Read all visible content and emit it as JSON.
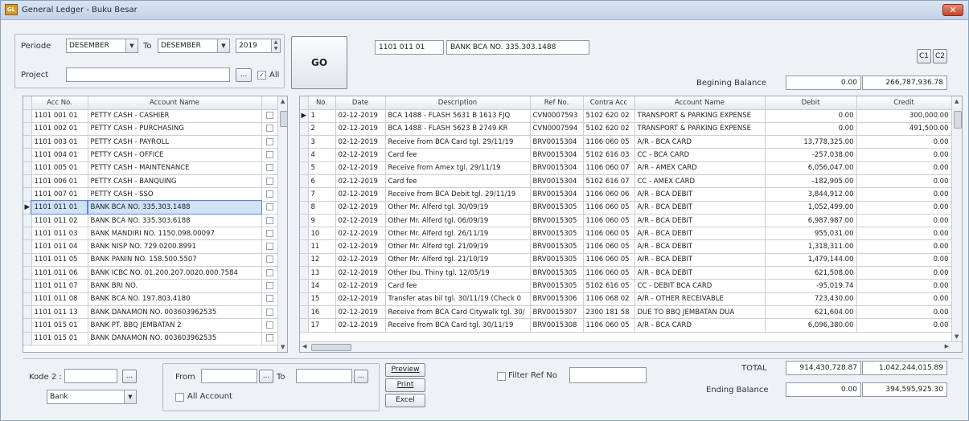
{
  "window": {
    "title": "General Ledger - Buku Besar",
    "close_label": "✕",
    "app_icon_label": "GL"
  },
  "filters": {
    "periode_label": "Periode",
    "period_from": "DESEMBER",
    "to_label": "To",
    "period_to": "DESEMBER",
    "year": "2019",
    "project_label": "Project",
    "project_value": "",
    "project_browse": "...",
    "all_label": "All",
    "go_label": "GO"
  },
  "account_header": {
    "code": "1101 011 01",
    "name": "BANK BCA NO. 335.303.1488",
    "c1_label": "C1",
    "c2_label": "C2"
  },
  "beginning_balance": {
    "label": "Begining Balance",
    "debit": "0.00",
    "credit": "266,787,936.78"
  },
  "accounts": {
    "headers": [
      "Acc No.",
      "Account Name"
    ],
    "rows": [
      {
        "no": "1101 001 01",
        "name": "PETTY CASH - CASHIER"
      },
      {
        "no": "1101 002 01",
        "name": "PETTY CASH - PURCHASING"
      },
      {
        "no": "1101 003 01",
        "name": "PETTY CASH - PAYROLL"
      },
      {
        "no": "1101 004 01",
        "name": "PETTY CASH - OFFICE"
      },
      {
        "no": "1101 005 01",
        "name": "PETTY CASH - MAINTENANCE"
      },
      {
        "no": "1101 006 01",
        "name": "PETTY CASH - BANQUING"
      },
      {
        "no": "1101 007 01",
        "name": "PETTY CASH - SSO"
      },
      {
        "no": "1101 011 01",
        "name": "BANK BCA NO. 335.303.1488"
      },
      {
        "no": "1101 011 02",
        "name": "BANK BCA NO. 335.303.6188"
      },
      {
        "no": "1101 011 03",
        "name": "BANK MANDIRI NO. 1150.098.00097"
      },
      {
        "no": "1101 011 04",
        "name": "BANK NISP NO. 729.0200.8991"
      },
      {
        "no": "1101 011 05",
        "name": "BANK PANIN NO. 158.500.5507"
      },
      {
        "no": "1101 011 06",
        "name": "BANK ICBC NO. 01.200.207.0020.000.7584"
      },
      {
        "no": "1101 011 07",
        "name": "BANK BRI NO."
      },
      {
        "no": "1101 011 08",
        "name": "BANK BCA NO. 197.803.4180"
      },
      {
        "no": "1101 011 13",
        "name": "BANK DANAMON NO. 003603962535"
      },
      {
        "no": "1101 015 01",
        "name": "BANK PT. BBQ JEMBATAN 2"
      },
      {
        "no": "1101 015 01",
        "name": "BANK DANAMON NO. 003603962535"
      }
    ]
  },
  "ledger": {
    "headers": [
      "No.",
      "Date",
      "Description",
      "Ref No.",
      "Contra Acc",
      "Account Name",
      "Debit",
      "Credit"
    ],
    "rows": [
      {
        "no": "1",
        "date": "02-12-2019",
        "desc": "BCA 1488 - FLASH 5631 B 1613 FJQ",
        "ref": "CVN0007593",
        "contra": "5102 620 02",
        "acct": "TRANSPORT & PARKING EXPENSE",
        "debit": "0.00",
        "credit": "300,000.00"
      },
      {
        "no": "2",
        "date": "02-12-2019",
        "desc": "BCA 1488 - FLASH 5623 B 2749 KR",
        "ref": "CVN0007594",
        "contra": "5102 620 02",
        "acct": "TRANSPORT & PARKING EXPENSE",
        "debit": "0.00",
        "credit": "491,500.00"
      },
      {
        "no": "3",
        "date": "02-12-2019",
        "desc": "Receive from BCA Card tgl. 29/11/19",
        "ref": "BRV0015304",
        "contra": "1106 060 05",
        "acct": "A/R - BCA CARD",
        "debit": "13,778,325.00",
        "credit": "0.00"
      },
      {
        "no": "4",
        "date": "02-12-2019",
        "desc": "Card fee",
        "ref": "BRV0015304",
        "contra": "5102 616 03",
        "acct": "CC - BCA CARD",
        "debit": "-257,038.00",
        "credit": "0.00"
      },
      {
        "no": "5",
        "date": "02-12-2019",
        "desc": "Receive from Amex tgl. 29/11/19",
        "ref": "BRV0015304",
        "contra": "1106 060 07",
        "acct": "A/R - AMEX CARD",
        "debit": "6,056,047.00",
        "credit": "0.00"
      },
      {
        "no": "6",
        "date": "02-12-2019",
        "desc": "Card fee",
        "ref": "BRV0015304",
        "contra": "5102 616 07",
        "acct": "CC - AMEX CARD",
        "debit": "-182,905.00",
        "credit": "0.00"
      },
      {
        "no": "7",
        "date": "02-12-2019",
        "desc": "Receive from BCA Debit tgl. 29/11/19",
        "ref": "BRV0015304",
        "contra": "1106 060 06",
        "acct": "A/R - BCA DEBIT",
        "debit": "3,844,912.00",
        "credit": "0.00"
      },
      {
        "no": "8",
        "date": "02-12-2019",
        "desc": "Other Mr. Alferd tgl. 30/09/19",
        "ref": "BRV0015305",
        "contra": "1106 060 05",
        "acct": "A/R - BCA DEBIT",
        "debit": "1,052,499.00",
        "credit": "0.00"
      },
      {
        "no": "9",
        "date": "02-12-2019",
        "desc": "Other Mr. Alferd tgl. 06/09/19",
        "ref": "BRV0015305",
        "contra": "1106 060 05",
        "acct": "A/R - BCA DEBIT",
        "debit": "6,987,987.00",
        "credit": "0.00"
      },
      {
        "no": "10",
        "date": "02-12-2019",
        "desc": "Other Mr. Alferd tgl. 26/11/19",
        "ref": "BRV0015305",
        "contra": "1106 060 05",
        "acct": "A/R - BCA DEBIT",
        "debit": "955,031.00",
        "credit": "0.00"
      },
      {
        "no": "11",
        "date": "02-12-2019",
        "desc": "Other Mr. Alferd tgl. 21/09/19",
        "ref": "BRV0015305",
        "contra": "1106 060 05",
        "acct": "A/R - BCA DEBIT",
        "debit": "1,318,311.00",
        "credit": "0.00"
      },
      {
        "no": "12",
        "date": "02-12-2019",
        "desc": "Other Mr. Alferd tgl. 21/10/19",
        "ref": "BRV0015305",
        "contra": "1106 060 05",
        "acct": "A/R - BCA DEBIT",
        "debit": "1,479,144.00",
        "credit": "0.00"
      },
      {
        "no": "13",
        "date": "02-12-2019",
        "desc": "Other Ibu. Thiny tgl. 12/05/19",
        "ref": "BRV0015305",
        "contra": "1106 060 05",
        "acct": "A/R - BCA DEBIT",
        "debit": "621,508.00",
        "credit": "0.00"
      },
      {
        "no": "14",
        "date": "02-12-2019",
        "desc": "Card fee",
        "ref": "BRV0015305",
        "contra": "5102 616 05",
        "acct": "CC - DEBIT BCA CARD",
        "debit": "-95,019.74",
        "credit": "0.00"
      },
      {
        "no": "15",
        "date": "02-12-2019",
        "desc": "Transfer atas bil tgl. 30/11/19 (Check 0",
        "ref": "BRV0015306",
        "contra": "1106 068 02",
        "acct": "A/R - OTHER RECEIVABLE",
        "debit": "723,430.00",
        "credit": "0.00"
      },
      {
        "no": "16",
        "date": "02-12-2019",
        "desc": "Receive from BCA Card Citywalk tgl. 30/",
        "ref": "BRV0015307",
        "contra": "2300 181 58",
        "acct": "DUE TO BBQ JEMBATAN DUA",
        "debit": "621,604.00",
        "credit": "0.00"
      },
      {
        "no": "17",
        "date": "02-12-2019",
        "desc": "Receive from BCA Card tgl. 30/11/19",
        "ref": "BRV0015308",
        "contra": "1106 060 05",
        "acct": "A/R - BCA CARD",
        "debit": "6,096,380.00",
        "credit": "0.00"
      }
    ]
  },
  "bottom": {
    "kode2_label": "Kode 2 :",
    "kode2_value": "",
    "kode_browse": "...",
    "bank_value": "Bank",
    "from_label": "From",
    "from_value": "",
    "from_browse": "...",
    "to_label": "To",
    "to_value": "",
    "to_browse": "...",
    "all_account_label": "All Account",
    "preview_label": "Preview",
    "print_label": "Print",
    "excel_label": "Excel",
    "filter_ref_label": "Filter Ref No",
    "filter_ref_value": "",
    "total_label": "TOTAL",
    "total_debit": "914,430,728.87",
    "total_credit": "1,042,244,015.89",
    "ending_label": "Ending Balance",
    "ending_debit": "0.00",
    "ending_credit": "394,595,925.30"
  }
}
